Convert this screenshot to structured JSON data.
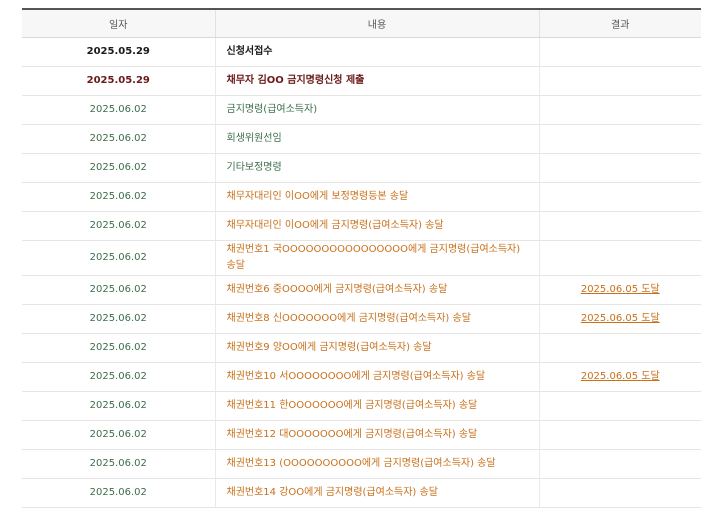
{
  "headers": {
    "date": "일자",
    "content": "내용",
    "result": "결과"
  },
  "rows": [
    {
      "date": "2025.05.29",
      "content": "신청서접수",
      "result": ""
    },
    {
      "date": "2025.05.29",
      "content": "채무자 김OO 금지명령신청 제출",
      "result": ""
    },
    {
      "date": "2025.06.02",
      "content": "금지명령(급여소득자)",
      "result": ""
    },
    {
      "date": "2025.06.02",
      "content": "회생위원선임",
      "result": ""
    },
    {
      "date": "2025.06.02",
      "content": "기타보정명령",
      "result": ""
    },
    {
      "date": "2025.06.02",
      "content": "채무자대리인 이OO에게 보정명령등본 송달",
      "result": ""
    },
    {
      "date": "2025.06.02",
      "content": "채무자대리인 이OO에게 금지명령(급여소득자) 송달",
      "result": ""
    },
    {
      "date": "2025.06.02",
      "content": "채권번호1 국OOOOOOOOOOOOOOOO에게 금지명령(급여소득자) 송달",
      "result": ""
    },
    {
      "date": "2025.06.02",
      "content": "채권번호6 중OOOO에게 금지명령(급여소득자) 송달",
      "result": "2025.06.05 도달"
    },
    {
      "date": "2025.06.02",
      "content": "채권번호8 신OOOOOOO에게 금지명령(급여소득자) 송달",
      "result": "2025.06.05 도달"
    },
    {
      "date": "2025.06.02",
      "content": "채권번호9 양OO에게 금지명령(급여소득자) 송달",
      "result": ""
    },
    {
      "date": "2025.06.02",
      "content": "채권번호10 서OOOOOOOO에게 금지명령(급여소득자) 송달",
      "result": "2025.06.05 도달"
    },
    {
      "date": "2025.06.02",
      "content": "채권번호11 한OOOOOOO에게 금지명령(급여소득자) 송달",
      "result": ""
    },
    {
      "date": "2025.06.02",
      "content": "채권번호12 대OOOOOOO에게 금지명령(급여소득자) 송달",
      "result": ""
    },
    {
      "date": "2025.06.02",
      "content": "채권번호13 (OOOOOOOOOO에게 금지명령(급여소득자) 송달",
      "result": ""
    },
    {
      "date": "2025.06.02",
      "content": "채권번호14 강OO에게 금지명령(급여소득자) 송달",
      "result": ""
    }
  ]
}
